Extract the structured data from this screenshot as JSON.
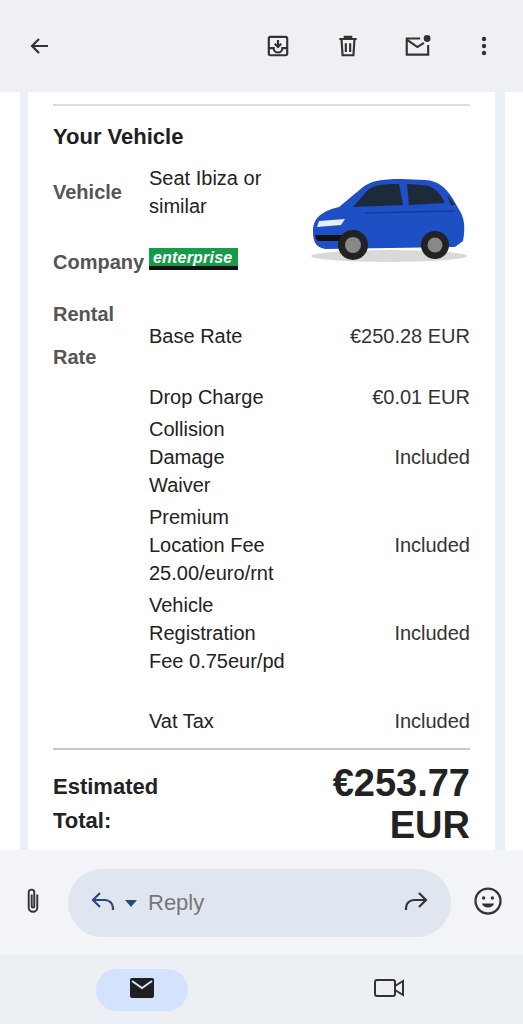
{
  "vehicle_section": {
    "title": "Your Vehicle",
    "vehicle_label": "Vehicle",
    "vehicle_value": "Seat Ibiza or similar",
    "company_label": "Company",
    "company_logo": "enterprise",
    "rate_label": "Rental Rate"
  },
  "charges": [
    {
      "name": "Base Rate",
      "amount": "€250.28 EUR"
    },
    {
      "name": "Drop Charge",
      "amount": "€0.01 EUR"
    },
    {
      "name": "Collision Damage Waiver",
      "amount": "Included"
    },
    {
      "name": "Premium Location Fee 25.00/euro/rnt",
      "amount": "Included"
    },
    {
      "name": "Vehicle Registration Fee 0.75eur/pd",
      "amount": "Included"
    },
    {
      "name": "Vat Tax",
      "amount": "Included"
    }
  ],
  "total": {
    "label": "Estimated Total:",
    "amount": "€253.77 EUR"
  },
  "reply_bar": {
    "placeholder": "Reply"
  },
  "bottom_nav": [
    {
      "selected": true
    },
    {
      "selected": false
    }
  ]
}
